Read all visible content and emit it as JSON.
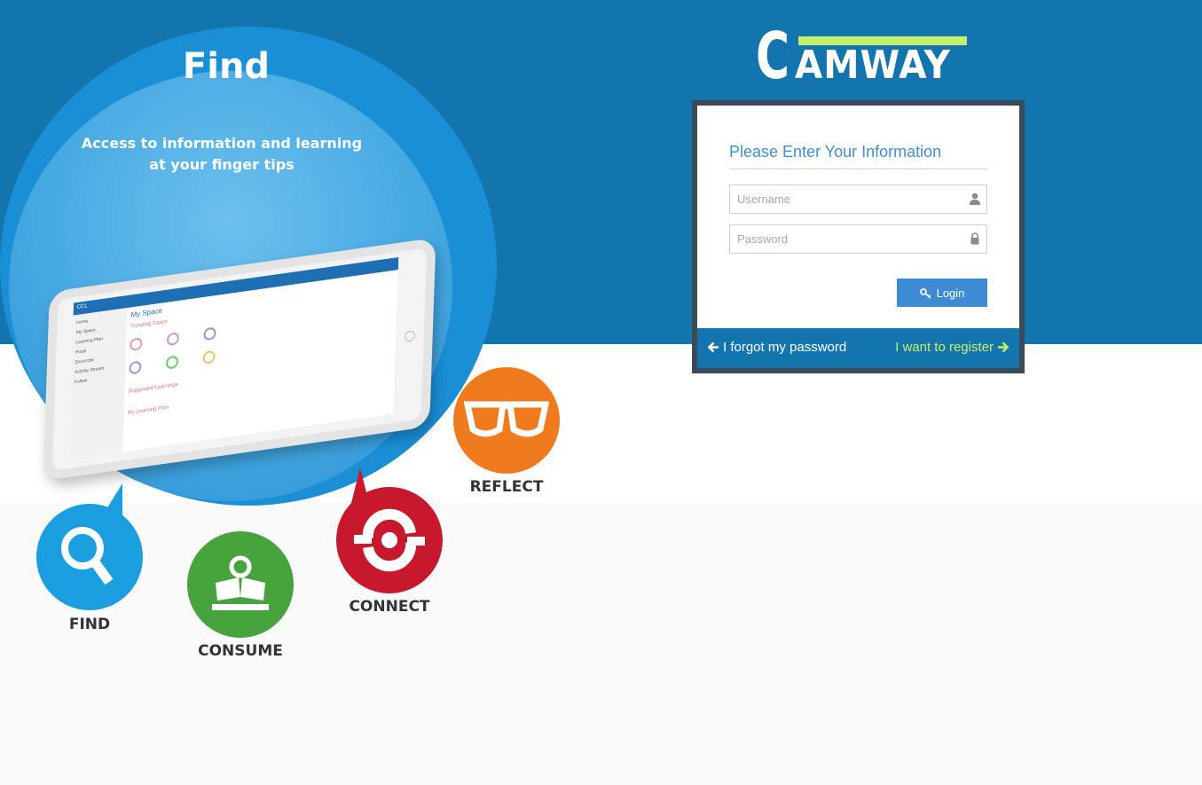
{
  "hero": {
    "title": "Find",
    "subtitle_line1": "Access to information and learning",
    "subtitle_line2": "at your finger tips"
  },
  "tablet": {
    "app_name": "CCL",
    "page_title": "My Space",
    "menu": [
      "Home",
      "My Space",
      "Learning Plan",
      "Posts",
      "Excercise",
      "Activity Stream",
      "Follow"
    ],
    "sections": [
      "Trending Topics",
      "Suggested Learnings",
      "My Learning Plan"
    ]
  },
  "features": [
    {
      "label": "FIND",
      "color": "#1a9ee0",
      "icon": "magnifier-icon"
    },
    {
      "label": "CONSUME",
      "color": "#47a43c",
      "icon": "reader-icon"
    },
    {
      "label": "CONNECT",
      "color": "#c8182e",
      "icon": "connect-icon"
    },
    {
      "label": "REFLECT",
      "color": "#f07b1e",
      "icon": "glasses-icon"
    }
  ],
  "logo": {
    "first_letter": "C",
    "rest": "AMWAY"
  },
  "login": {
    "title": "Please Enter Your Information",
    "username_placeholder": "Username",
    "password_placeholder": "Password",
    "login_label": "Login",
    "forgot_label": "I forgot my password",
    "register_label": "I want to register"
  },
  "colors": {
    "header_blue": "#1474ad",
    "accent_green": "#c4ef6a",
    "button_blue": "#3d8bd2",
    "title_blue": "#3e8ed0"
  }
}
